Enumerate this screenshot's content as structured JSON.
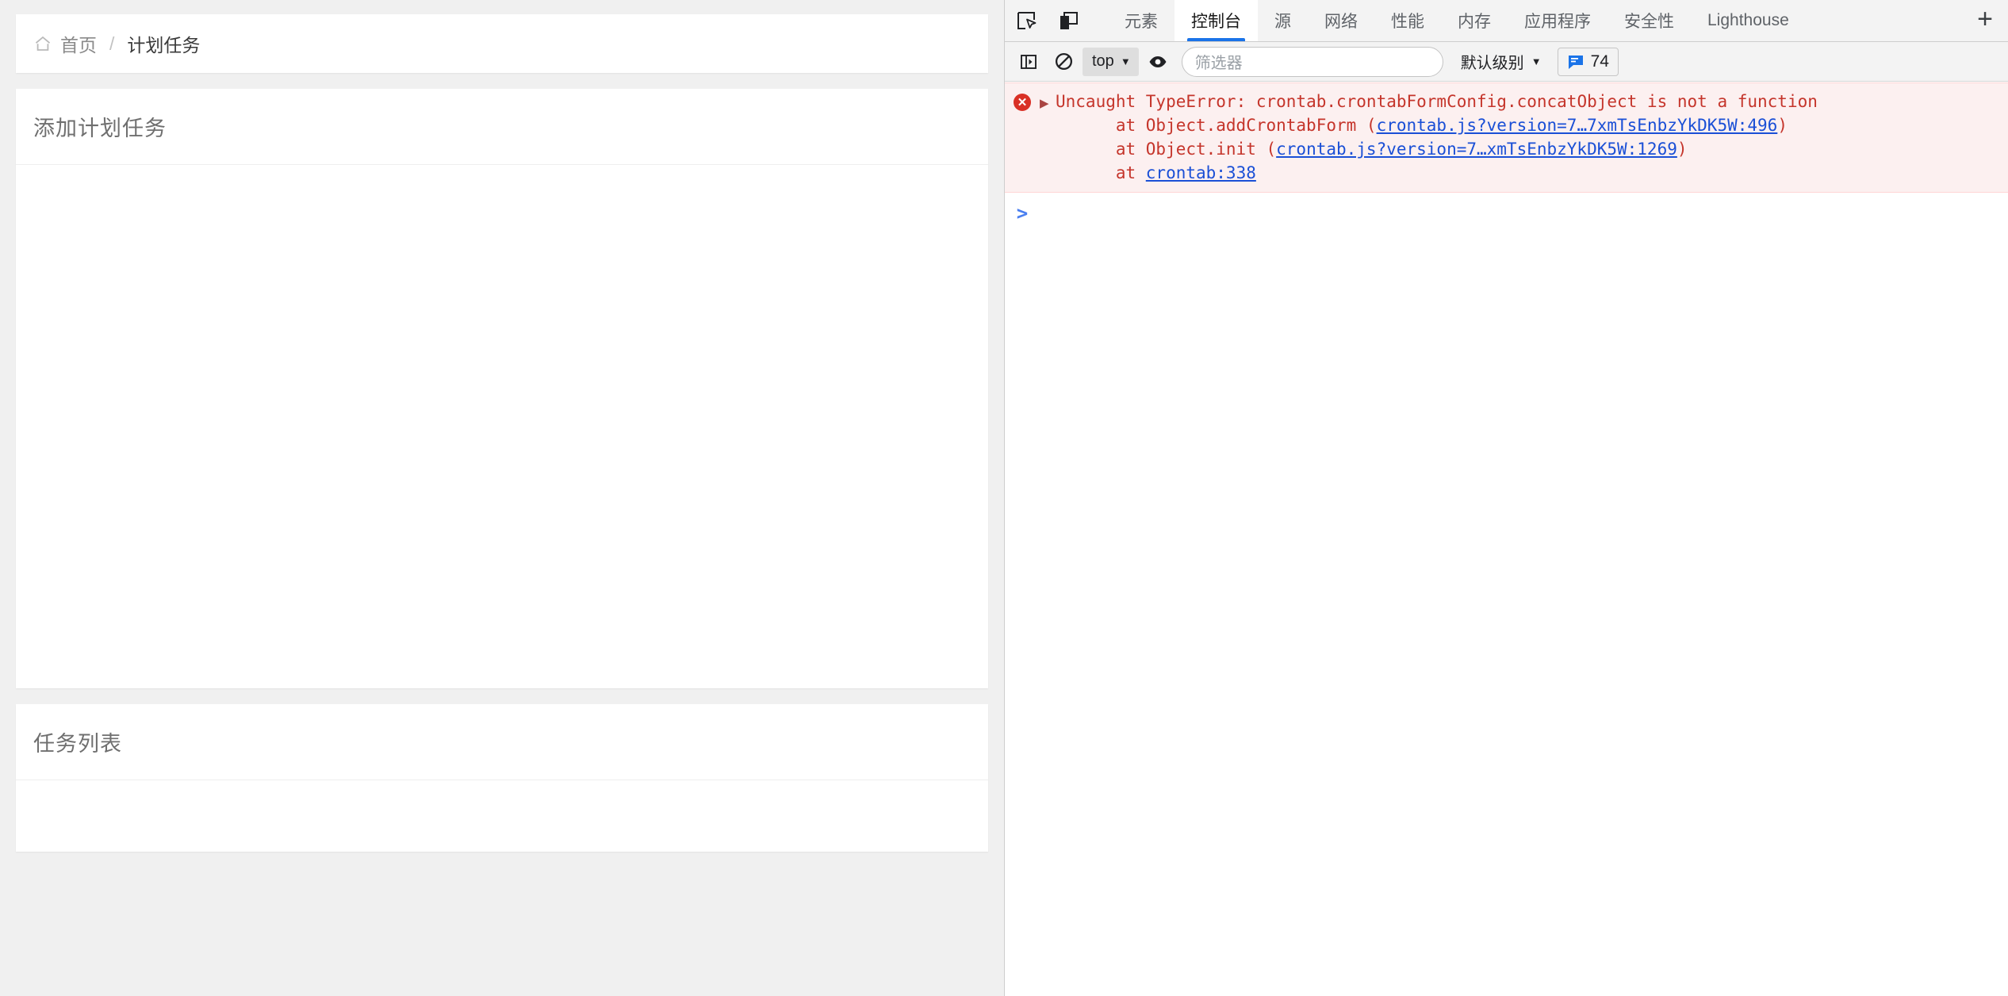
{
  "page": {
    "breadcrumb": {
      "home_icon": "home-icon",
      "home": "首页",
      "separator": "/",
      "current": "计划任务"
    },
    "cards": [
      {
        "title": "添加计划任务"
      },
      {
        "title": "任务列表"
      }
    ]
  },
  "devtools": {
    "toolbar_icons": [
      {
        "name": "inspect-element-icon"
      },
      {
        "name": "device-toolbar-icon"
      }
    ],
    "tabs": [
      {
        "label": "元素",
        "active": false
      },
      {
        "label": "控制台",
        "active": true
      },
      {
        "label": "源",
        "active": false
      },
      {
        "label": "网络",
        "active": false
      },
      {
        "label": "性能",
        "active": false
      },
      {
        "label": "内存",
        "active": false
      },
      {
        "label": "应用程序",
        "active": false
      },
      {
        "label": "安全性",
        "active": false
      },
      {
        "label": "Lighthouse",
        "active": false
      }
    ],
    "more_tabs_label": "+",
    "console_toolbar": {
      "sidebar_toggle_icon": "console-sidebar-icon",
      "clear_console_icon": "clear-console-icon",
      "context_selector": "top",
      "live_expression_icon": "eye-icon",
      "filter_placeholder": "筛选器",
      "filter_value": "",
      "level_selector": "默认级别",
      "issues_count": "74",
      "issues_icon": "issues-icon"
    },
    "console": {
      "messages": [
        {
          "type": "error",
          "expand_icon": "triangle-right-icon",
          "status_icon": "error-circle-icon",
          "title": "Uncaught TypeError: crontab.crontabFormConfig.concatObject is not a function",
          "stack": [
            {
              "prefix": "at Object.addCrontabForm (",
              "link": "crontab.js?version=7…7xmTsEnbzYkDK5W:496",
              "suffix": ")"
            },
            {
              "prefix": "at Object.init (",
              "link": "crontab.js?version=7…xmTsEnbzYkDK5W:1269",
              "suffix": ")"
            },
            {
              "prefix": "at ",
              "link": "crontab:338",
              "suffix": ""
            }
          ]
        }
      ],
      "prompt_caret": ">",
      "prompt_value": ""
    }
  },
  "colors": {
    "accent": "#1a73e8",
    "error_text": "#c5352b",
    "error_bg": "#fcf0f0",
    "link": "#1a4fd6",
    "page_bg": "#f0f0f0"
  }
}
